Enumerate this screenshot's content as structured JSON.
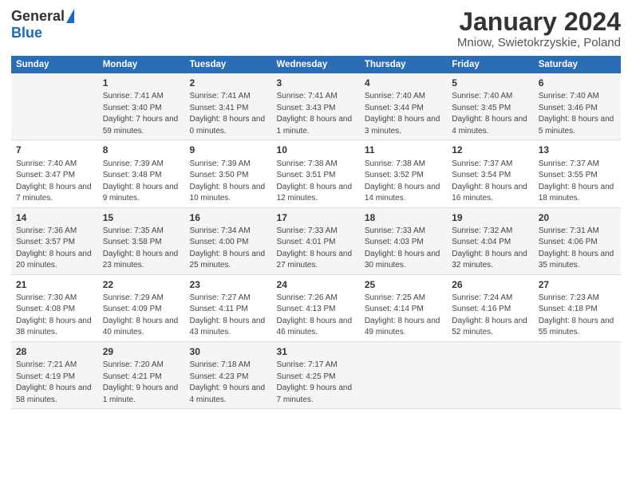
{
  "logo": {
    "general": "General",
    "blue": "Blue"
  },
  "title": "January 2024",
  "subtitle": "Mniow, Swietokrzyskie, Poland",
  "columns": [
    "Sunday",
    "Monday",
    "Tuesday",
    "Wednesday",
    "Thursday",
    "Friday",
    "Saturday"
  ],
  "weeks": [
    {
      "days": [
        {
          "num": "",
          "sunrise": "",
          "sunset": "",
          "daylight": ""
        },
        {
          "num": "1",
          "sunrise": "Sunrise: 7:41 AM",
          "sunset": "Sunset: 3:40 PM",
          "daylight": "Daylight: 7 hours and 59 minutes."
        },
        {
          "num": "2",
          "sunrise": "Sunrise: 7:41 AM",
          "sunset": "Sunset: 3:41 PM",
          "daylight": "Daylight: 8 hours and 0 minutes."
        },
        {
          "num": "3",
          "sunrise": "Sunrise: 7:41 AM",
          "sunset": "Sunset: 3:43 PM",
          "daylight": "Daylight: 8 hours and 1 minute."
        },
        {
          "num": "4",
          "sunrise": "Sunrise: 7:40 AM",
          "sunset": "Sunset: 3:44 PM",
          "daylight": "Daylight: 8 hours and 3 minutes."
        },
        {
          "num": "5",
          "sunrise": "Sunrise: 7:40 AM",
          "sunset": "Sunset: 3:45 PM",
          "daylight": "Daylight: 8 hours and 4 minutes."
        },
        {
          "num": "6",
          "sunrise": "Sunrise: 7:40 AM",
          "sunset": "Sunset: 3:46 PM",
          "daylight": "Daylight: 8 hours and 5 minutes."
        }
      ]
    },
    {
      "days": [
        {
          "num": "7",
          "sunrise": "Sunrise: 7:40 AM",
          "sunset": "Sunset: 3:47 PM",
          "daylight": "Daylight: 8 hours and 7 minutes."
        },
        {
          "num": "8",
          "sunrise": "Sunrise: 7:39 AM",
          "sunset": "Sunset: 3:48 PM",
          "daylight": "Daylight: 8 hours and 9 minutes."
        },
        {
          "num": "9",
          "sunrise": "Sunrise: 7:39 AM",
          "sunset": "Sunset: 3:50 PM",
          "daylight": "Daylight: 8 hours and 10 minutes."
        },
        {
          "num": "10",
          "sunrise": "Sunrise: 7:38 AM",
          "sunset": "Sunset: 3:51 PM",
          "daylight": "Daylight: 8 hours and 12 minutes."
        },
        {
          "num": "11",
          "sunrise": "Sunrise: 7:38 AM",
          "sunset": "Sunset: 3:52 PM",
          "daylight": "Daylight: 8 hours and 14 minutes."
        },
        {
          "num": "12",
          "sunrise": "Sunrise: 7:37 AM",
          "sunset": "Sunset: 3:54 PM",
          "daylight": "Daylight: 8 hours and 16 minutes."
        },
        {
          "num": "13",
          "sunrise": "Sunrise: 7:37 AM",
          "sunset": "Sunset: 3:55 PM",
          "daylight": "Daylight: 8 hours and 18 minutes."
        }
      ]
    },
    {
      "days": [
        {
          "num": "14",
          "sunrise": "Sunrise: 7:36 AM",
          "sunset": "Sunset: 3:57 PM",
          "daylight": "Daylight: 8 hours and 20 minutes."
        },
        {
          "num": "15",
          "sunrise": "Sunrise: 7:35 AM",
          "sunset": "Sunset: 3:58 PM",
          "daylight": "Daylight: 8 hours and 23 minutes."
        },
        {
          "num": "16",
          "sunrise": "Sunrise: 7:34 AM",
          "sunset": "Sunset: 4:00 PM",
          "daylight": "Daylight: 8 hours and 25 minutes."
        },
        {
          "num": "17",
          "sunrise": "Sunrise: 7:33 AM",
          "sunset": "Sunset: 4:01 PM",
          "daylight": "Daylight: 8 hours and 27 minutes."
        },
        {
          "num": "18",
          "sunrise": "Sunrise: 7:33 AM",
          "sunset": "Sunset: 4:03 PM",
          "daylight": "Daylight: 8 hours and 30 minutes."
        },
        {
          "num": "19",
          "sunrise": "Sunrise: 7:32 AM",
          "sunset": "Sunset: 4:04 PM",
          "daylight": "Daylight: 8 hours and 32 minutes."
        },
        {
          "num": "20",
          "sunrise": "Sunrise: 7:31 AM",
          "sunset": "Sunset: 4:06 PM",
          "daylight": "Daylight: 8 hours and 35 minutes."
        }
      ]
    },
    {
      "days": [
        {
          "num": "21",
          "sunrise": "Sunrise: 7:30 AM",
          "sunset": "Sunset: 4:08 PM",
          "daylight": "Daylight: 8 hours and 38 minutes."
        },
        {
          "num": "22",
          "sunrise": "Sunrise: 7:29 AM",
          "sunset": "Sunset: 4:09 PM",
          "daylight": "Daylight: 8 hours and 40 minutes."
        },
        {
          "num": "23",
          "sunrise": "Sunrise: 7:27 AM",
          "sunset": "Sunset: 4:11 PM",
          "daylight": "Daylight: 8 hours and 43 minutes."
        },
        {
          "num": "24",
          "sunrise": "Sunrise: 7:26 AM",
          "sunset": "Sunset: 4:13 PM",
          "daylight": "Daylight: 8 hours and 46 minutes."
        },
        {
          "num": "25",
          "sunrise": "Sunrise: 7:25 AM",
          "sunset": "Sunset: 4:14 PM",
          "daylight": "Daylight: 8 hours and 49 minutes."
        },
        {
          "num": "26",
          "sunrise": "Sunrise: 7:24 AM",
          "sunset": "Sunset: 4:16 PM",
          "daylight": "Daylight: 8 hours and 52 minutes."
        },
        {
          "num": "27",
          "sunrise": "Sunrise: 7:23 AM",
          "sunset": "Sunset: 4:18 PM",
          "daylight": "Daylight: 8 hours and 55 minutes."
        }
      ]
    },
    {
      "days": [
        {
          "num": "28",
          "sunrise": "Sunrise: 7:21 AM",
          "sunset": "Sunset: 4:19 PM",
          "daylight": "Daylight: 8 hours and 58 minutes."
        },
        {
          "num": "29",
          "sunrise": "Sunrise: 7:20 AM",
          "sunset": "Sunset: 4:21 PM",
          "daylight": "Daylight: 9 hours and 1 minute."
        },
        {
          "num": "30",
          "sunrise": "Sunrise: 7:18 AM",
          "sunset": "Sunset: 4:23 PM",
          "daylight": "Daylight: 9 hours and 4 minutes."
        },
        {
          "num": "31",
          "sunrise": "Sunrise: 7:17 AM",
          "sunset": "Sunset: 4:25 PM",
          "daylight": "Daylight: 9 hours and 7 minutes."
        },
        {
          "num": "",
          "sunrise": "",
          "sunset": "",
          "daylight": ""
        },
        {
          "num": "",
          "sunrise": "",
          "sunset": "",
          "daylight": ""
        },
        {
          "num": "",
          "sunrise": "",
          "sunset": "",
          "daylight": ""
        }
      ]
    }
  ]
}
